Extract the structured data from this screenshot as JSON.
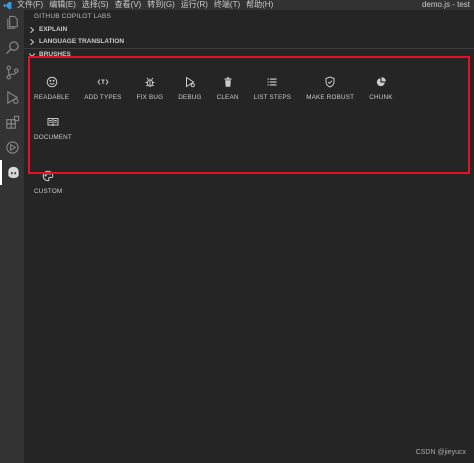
{
  "menubar": {
    "items": [
      "文件(F)",
      "编辑(E)",
      "选择(S)",
      "查看(V)",
      "转到(G)",
      "运行(R)",
      "终端(T)",
      "帮助(H)"
    ],
    "window_title": "demo.js - test"
  },
  "sidebar": {
    "pane_title": "GITHUB COPILOT LABS",
    "sections": [
      {
        "label": "EXPLAIN",
        "expanded": false
      },
      {
        "label": "LANGUAGE TRANSLATION",
        "expanded": false
      },
      {
        "label": "BRUSHES",
        "expanded": true
      }
    ]
  },
  "brushes": [
    {
      "label": "READABLE",
      "icon": "smiley-icon"
    },
    {
      "label": "ADD TYPES",
      "icon": "type-tag-icon"
    },
    {
      "label": "FIX BUG",
      "icon": "bug-icon"
    },
    {
      "label": "DEBUG",
      "icon": "debug-icon"
    },
    {
      "label": "CLEAN",
      "icon": "trash-icon"
    },
    {
      "label": "LIST STEPS",
      "icon": "list-icon"
    },
    {
      "label": "MAKE ROBUST",
      "icon": "shield-icon"
    },
    {
      "label": "CHUNK",
      "icon": "pie-icon"
    },
    {
      "label": "DOCUMENT",
      "icon": "book-icon"
    },
    {
      "label": "CUSTOM",
      "icon": "palette-icon"
    }
  ],
  "watermark": "CSDN @jieyucx",
  "colors": {
    "highlight_border": "#e81123",
    "sidebar_bg": "#252526",
    "activitybar_bg": "#333333"
  }
}
